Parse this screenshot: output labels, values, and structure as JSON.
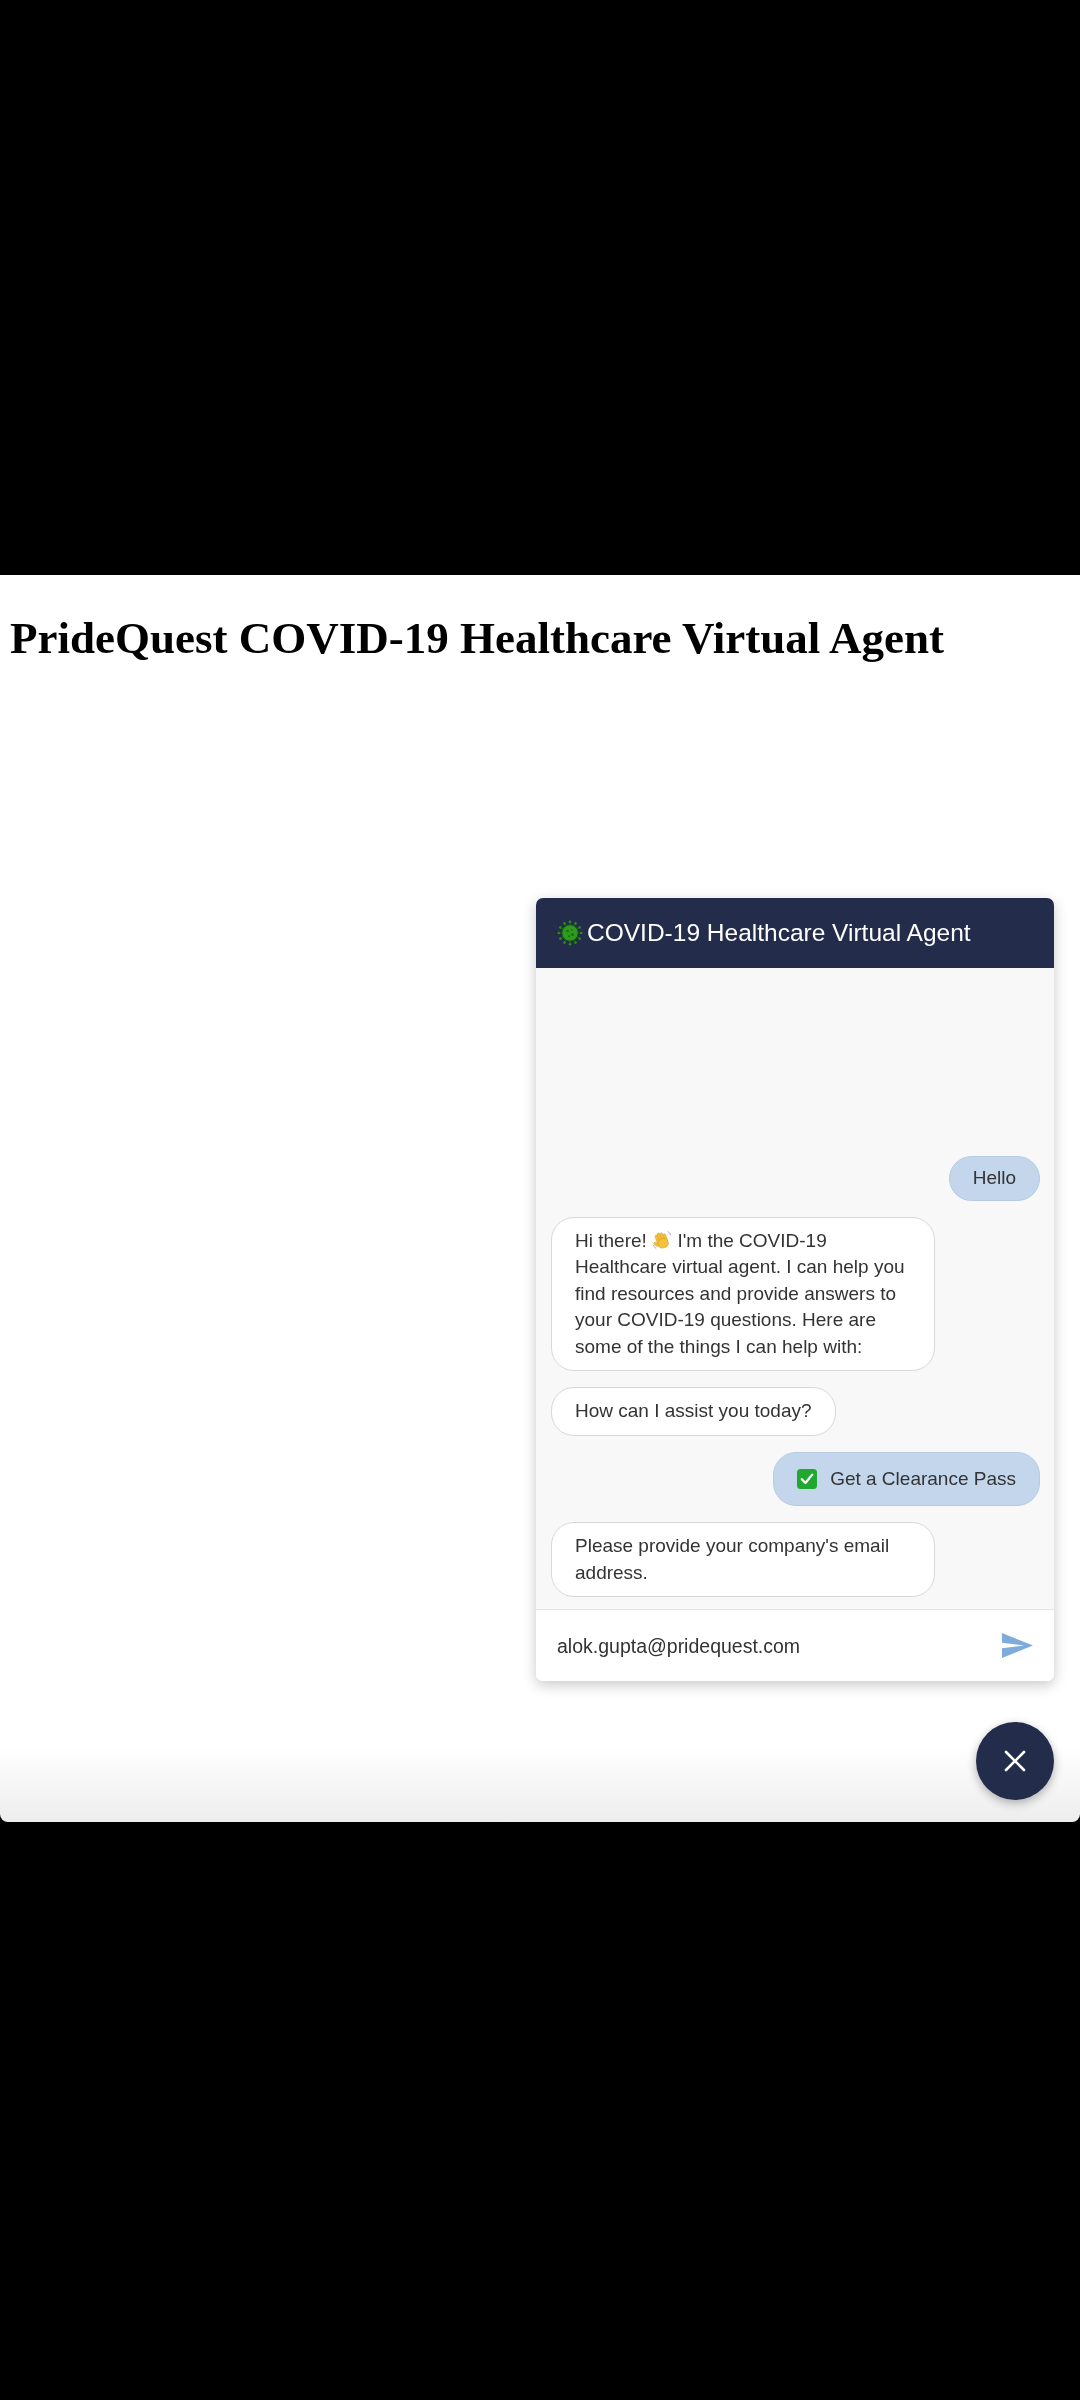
{
  "page": {
    "title": "PrideQuest COVID-19 Healthcare Virtual Agent"
  },
  "chat": {
    "title": "COVID-19 Healthcare Virtual Agent",
    "messages": [
      {
        "outgoing": true,
        "kind": "text",
        "text": "Hello"
      },
      {
        "outgoing": false,
        "kind": "greeting",
        "lead": "Hi there!",
        "text": "I'm the COVID-19 Healthcare virtual agent. I can help you find resources and provide answers to your COVID-19 questions. Here are some of the things I can help with:"
      },
      {
        "outgoing": false,
        "kind": "text",
        "text": "How can I assist you today?"
      },
      {
        "outgoing": true,
        "kind": "option",
        "text": "Get a Clearance Pass"
      },
      {
        "outgoing": false,
        "kind": "text",
        "text": "Please provide your company's email address."
      }
    ],
    "input": {
      "value": "alok.gupta@pridequest.com"
    }
  }
}
